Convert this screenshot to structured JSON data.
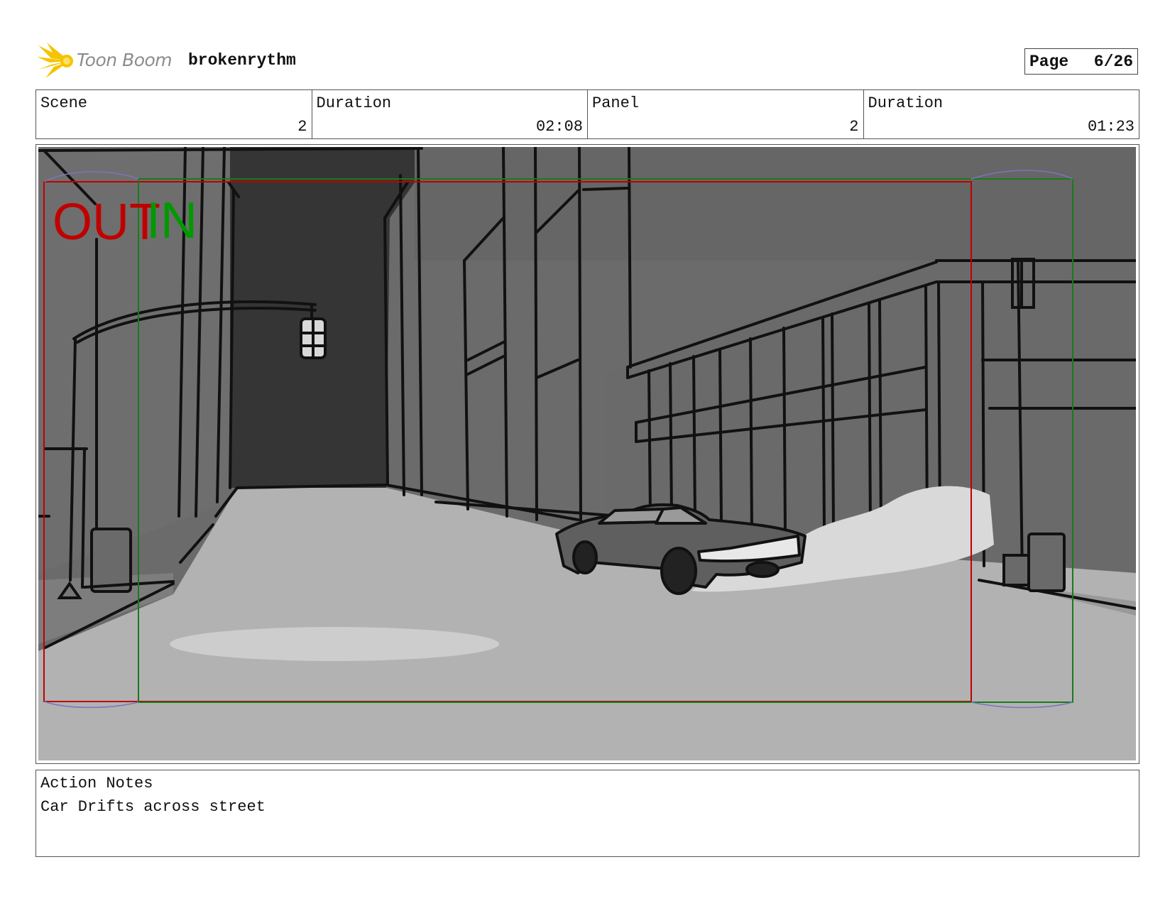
{
  "header": {
    "brand": "Toon Boom",
    "project": "brokenrythm",
    "page_label": "Page",
    "page_value": "6/26"
  },
  "info": {
    "scene_label": "Scene",
    "scene_value": "2",
    "scene_duration_label": "Duration",
    "scene_duration_value": "02:08",
    "panel_label": "Panel",
    "panel_value": "2",
    "panel_duration_label": "Duration",
    "panel_duration_value": "01:23"
  },
  "panel": {
    "frame_out_label": "OUT",
    "frame_in_label": "IN",
    "out_color": "#c00000",
    "in_color": "#009900"
  },
  "notes": {
    "label": "Action Notes",
    "text": "Car Drifts across street"
  }
}
